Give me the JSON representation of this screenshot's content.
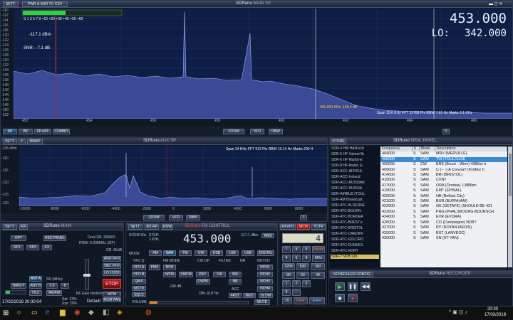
{
  "main_sp": {
    "title": "SDRuno",
    "subtitle": "MAIN SP",
    "sett": "SETT.",
    "pwr_btn": "PWR & SNR TO CSV",
    "dbm": "-117.1 dBm",
    "snr": "SNR: - 7.1 dB",
    "s_scale": "S 1 3 5 7 9 +10 +20 +30 +40 +50 +60",
    "big_freq": "453.000",
    "lo_label": "LO:",
    "lo_freq": "342.000",
    "y_ticks": [
      "-110",
      "-112",
      "-114",
      "-116",
      "-118",
      "-120",
      "-122",
      "-124",
      "-126",
      "-128",
      "-130",
      "-132",
      "-134",
      "-136",
      "-138",
      "-140",
      "-142",
      "-144",
      "-146",
      "-148",
      "-150",
      "-152"
    ],
    "x_ticks": [
      "452",
      "454",
      "456",
      "458",
      "460",
      "462",
      "464",
      "466"
    ],
    "cursor_label": "461.000 KHz -148.4 dB",
    "span_info": "Span 15.6 KHz  FFT 32768 Pts  RBW 7.63 Hz  Marks 0.1 KHz",
    "buttons": {
      "sp": "SP",
      "wf": "WF",
      "spwf": "SP+WF",
      "combo": "COMBO",
      "zoom": "ZOOM",
      "vfo": "VFO",
      "rbw": "RBW"
    },
    "page": "1"
  },
  "aux_sp": {
    "title": "SDRuno",
    "subtitle": "AUX SP",
    "sett": "SETT.",
    "f": "F",
    "mmap": "MMAP",
    "span_info": "Span 24 KHz  FFT 912 Pts  RBW 13.14 Hz  Marks 200 H",
    "y_ticks": [
      "-105 dBm",
      "-110",
      "-115",
      "-120",
      "-125",
      "-130"
    ],
    "x_ticks": [
      "-10000",
      "-8000",
      "-6000",
      "-4000",
      "-2000",
      "0",
      "2000",
      "4000",
      "6000",
      "8000"
    ],
    "buttons": {
      "zoom": "ZOOM",
      "vfo": "VFO",
      "rbw": "RBW"
    },
    "page": "1"
  },
  "mem_panel": {
    "store": "STORE",
    "title": "SDRuno",
    "subtitle": "MEM. PANEL",
    "groups": [
      "SDR-4 HM HAM.s1b",
      "SDR-5 HF Volmet Br",
      "SDR-6 HF Maritime",
      "SDR-8 HF Arabic G",
      "SDR-ACC-AFRICA",
      "SDR-ACC-Iceland",
      "SDR-ACC-RUSSIAN",
      "SDR-ACC-RUSSIA",
      "SDR-AIRBUS (TOUL",
      "SDR-AM Broadcast",
      "SDR-ATC-ALDERNE",
      "SDR-ATC-BOURN",
      "SDR-ATC-BORDEA",
      "SDR-ATC-BREST.s",
      "SDR-ATC-BRISTOL",
      "SDR-ATC-CARDIFF",
      "SDR-ATC-GOLDRO",
      "SDR-ATC-DUNKES",
      "SDR-ATC-NORT",
      "SDR-7 NDB.s1b"
    ],
    "headers": [
      "Frequency",
      "S",
      "Mode",
      "Description"
    ],
    "rows": [
      [
        "404000",
        "S",
        "SAM",
        "MRV (MERVILLE)"
      ],
      [
        "406000",
        "S",
        "SAM",
        "TW (TOULOUSE"
      ],
      [
        "409000",
        "S",
        "CW",
        "BRK (Bruck - Wien) 408khz h"
      ],
      [
        "409000",
        "S",
        "SAM",
        "C  (-- -) A Coruna? (410khz h"
      ],
      [
        "414000",
        "S",
        "SAM",
        "BRI (BRISTOL)"
      ],
      [
        "415000",
        "S",
        "SAM",
        "CVN?"
      ],
      [
        "417000",
        "S",
        "SAM",
        "ORA (Oradea) 1,888km"
      ],
      [
        "419000",
        "S",
        "SAM",
        "EMT (EPINAL)"
      ],
      [
        "420000",
        "S",
        "SAM",
        "HB (Belfast City)"
      ],
      [
        "421000",
        "S",
        "SAM",
        "BUR (BURNHAM)"
      ],
      [
        "422000",
        "S",
        "SAM",
        "GE (GETAFE) (SHOULD BE 421"
      ],
      [
        "423000",
        "S",
        "SAM",
        "PHG (PHALSBOURG-BOURSCH"
      ],
      [
        "424000",
        "S",
        "SAM",
        "EVR (EVORA)"
      ],
      [
        "426000",
        "S",
        "SAM",
        "CO (Compiègne) NDB?"
      ],
      [
        "427000",
        "S",
        "SAM",
        "RY (ROYAN-MEDIS)"
      ],
      [
        "429000",
        "S",
        "SAM",
        "BST (LANVEOC)"
      ],
      [
        "430000",
        "S",
        "SAM",
        "SN (ST-YAN)"
      ]
    ]
  },
  "main": {
    "sett": "SETT.",
    "rx": "RX",
    "title": "SDRuno",
    "subtitle": "MAIN",
    "opt": "OPT",
    "rec_panel": "REC PANEL",
    "final_sr": "Final SR: 250000",
    "ifbw": "IFBW: 0.200MHz (ZIF)",
    "gr": "GR: 65dB",
    "sp1": "SP1",
    "sp2": "SP2",
    "ex": "EX",
    "rf_gain": "RF Gain Reduction",
    "ant_a": "ANT A",
    "bias_t": "BIAS-T",
    "ant_b": "ANT B",
    "hiz": "HI Z",
    "sr_mhz": "SR (MHz):",
    "sr_val": "2.0",
    "dec": "8",
    "am_fm": "AM/FM",
    "stop": "STOP",
    "add_vfo": "ADD VFO",
    "del_vfo": "DEL VFO",
    "lo_lock": "LO LOCK",
    "mcm": "MCM",
    "mcm_pan": "MCM PAN",
    "sdr": "Sdr: 22%",
    "sys": "Sys: 20%",
    "datetime": "17/02/2018 20:30:04",
    "workspace": "Default"
  },
  "rx_control": {
    "title": "SDRuno",
    "subtitle": "RX CONTROL",
    "sett": "SETT.",
    "rxrf": "RX RF",
    "rdw": "RDW",
    "step": "STEP:",
    "step_val": "1 KHz",
    "dcem": "DCEM 50s",
    "freq": "453.000",
    "dbm": "-117.1 dBm",
    "rms": "RMS",
    "modes": [
      "AM",
      "SAM",
      "FM",
      "CW",
      "DSB",
      "LSB",
      "USB",
      "DIGITAL"
    ],
    "mode_label": "MODE",
    "vfo_q": "VFO Q",
    "fm_mode": "FM MODE",
    "cw_op": "CW OP",
    "filter": "FILTER",
    "nr": "NR",
    "notch": "NOTCH",
    "vfo_a": "VFO A",
    "vfo_b": "VFO B",
    "fms": "FMS",
    "wfm": "WFM",
    "swfm": "SWFM",
    "nfm": "NFM",
    "zap": "ZAP",
    "filt": "11K",
    "t1": "36K",
    "nch1": "NCH1",
    "nch2": "NCH2",
    "nch3": "NCH3",
    "nch4": "NCH4",
    "qmx": "QMX",
    "cwpk": "CWPK",
    "nb": "NB",
    "sqlc": "SQLC",
    "agc": "AGC",
    "offs": "Offs 16.8 Hz",
    "dbv": "-136 dB",
    "mstr": "MSTR",
    "fast": "FAST",
    "med": "MED",
    "slow": "SLOW",
    "volume": "VOLUME",
    "mute": "MUTE"
  },
  "vfo": {
    "rxvfo": "RXVFO",
    "mcm": "MCM",
    "tctr": "TCTR",
    "big": "4",
    "keypad": [
      "7",
      "8",
      "9",
      "4",
      "5",
      "6",
      "1",
      "2",
      "3",
      "0",
      "."
    ],
    "bands": [
      "Bands",
      "MHz"
    ],
    "vals": [
      "2200",
      "630",
      "160",
      "80",
      "60",
      "40"
    ],
    "clear": "Clear",
    "enter": "Enter",
    "n15": "15"
  },
  "recorder": {
    "title": "SDRuno",
    "subtitle": "RECORDER",
    "sched": "SCHEDULER CONFIG"
  },
  "taskbar": {
    "time": "20:30",
    "date": "17/02/2018"
  }
}
